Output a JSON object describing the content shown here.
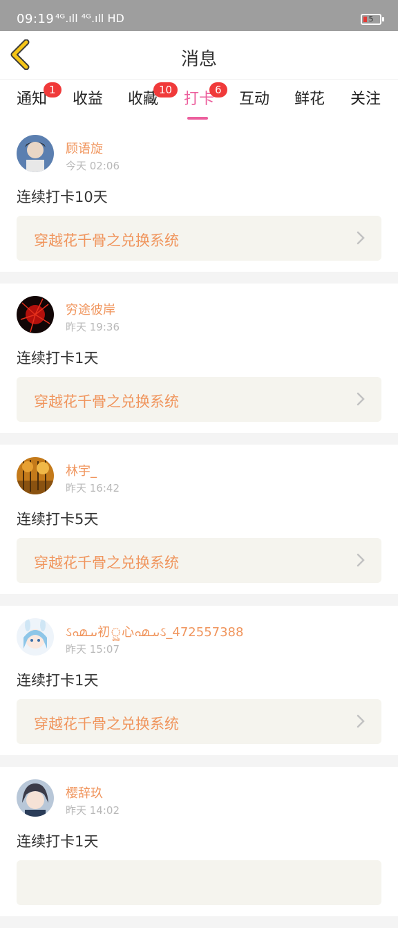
{
  "status_bar": {
    "time": "09:19",
    "signal_text": "⁴ᴳ.ıll ⁴ᴳ.ıll HD",
    "battery_level": "5",
    "battery_color": "#e53935"
  },
  "header": {
    "title": "消息",
    "back_icon": "chevron-left-icon",
    "back_icon_color": "#f5c518"
  },
  "tabs": [
    {
      "label": "通知",
      "badge": "1",
      "active": false
    },
    {
      "label": "收益",
      "badge": "",
      "active": false
    },
    {
      "label": "收藏",
      "badge": "10",
      "active": false
    },
    {
      "label": "打卡",
      "badge": "6",
      "active": true
    },
    {
      "label": "互动",
      "badge": "",
      "active": false
    },
    {
      "label": "鲜花",
      "badge": "",
      "active": false
    },
    {
      "label": "关注",
      "badge": "",
      "active": false
    }
  ],
  "colors": {
    "accent": "#ec5f9d",
    "name": "#f0955d",
    "badge": "#f03a3a"
  },
  "feed": [
    {
      "name": "顾语旋",
      "time": "今天 02:06",
      "message": "连续打卡10天",
      "book": "穿越花千骨之兑换系统"
    },
    {
      "name": "穷途彼岸",
      "time": "昨天 19:36",
      "message": "连续打卡1天",
      "book": "穿越花千骨之兑换系统"
    },
    {
      "name": "林宇_",
      "time": "昨天 16:42",
      "message": "连续打卡5天",
      "book": "穿越花千骨之兑换系统"
    },
    {
      "name": "ઽ൶ىىـ初ৣ心൶ىىـઽ_472557388",
      "time": "昨天 15:07",
      "message": "连续打卡1天",
      "book": "穿越花千骨之兑换系统"
    },
    {
      "name": "樱辞玖",
      "time": "昨天 14:02",
      "message": "连续打卡1天",
      "book": ""
    }
  ]
}
